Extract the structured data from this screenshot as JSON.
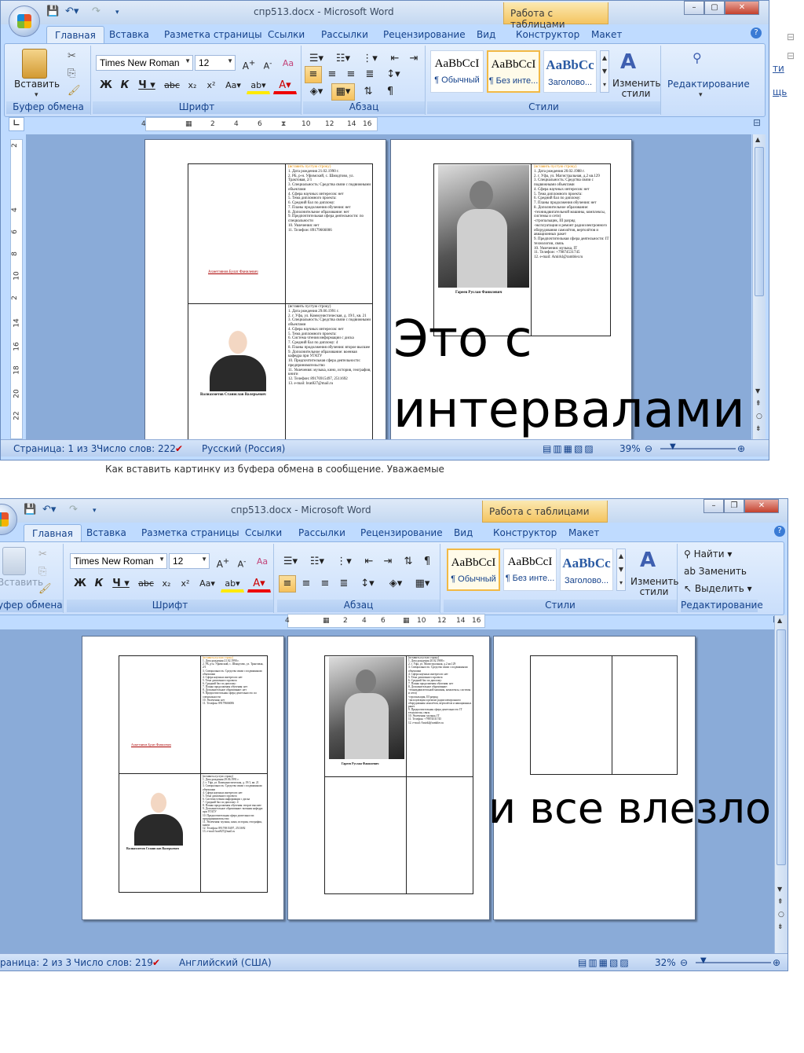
{
  "top": {
    "title": "спр513.docx - Microsoft Word",
    "context_tab": "Работа с таблицами",
    "tabs": [
      "Главная",
      "Вставка",
      "Разметка страницы",
      "Ссылки",
      "Рассылки",
      "Рецензирование",
      "Вид",
      "Конструктор",
      "Макет"
    ],
    "font_name": "Times New Roman",
    "font_size": "12",
    "paste": "Вставить",
    "styles": [
      {
        "sample": "AaBbCcI",
        "name": "¶ Обычный"
      },
      {
        "sample": "AaBbCcI",
        "name": "¶ Без инте..."
      },
      {
        "sample": "AaBbCc",
        "name": "Заголово..."
      }
    ],
    "change_styles": "Изменить стили",
    "editing": "Редактирование",
    "groups": [
      "Буфер обмена",
      "Шрифт",
      "Абзац",
      "Стили"
    ],
    "ruler": [
      "4",
      "2",
      "4",
      "6",
      "8",
      "10",
      "12",
      "14",
      "16"
    ],
    "vruler": [
      "2",
      "2",
      "4",
      "6",
      "8",
      "10",
      "12",
      "14",
      "16",
      "18",
      "20",
      "22"
    ],
    "status": {
      "page": "Страница: 1 из 3",
      "words": "Число слов: 222",
      "lang": "Русский (Россия)",
      "zoom": "39%"
    },
    "annotation": "Это с\nинтервалами",
    "side_links": [
      "ти",
      "щь"
    ],
    "below_text": "Как вставить картинку из буфера обмена в сообщение. Уважаемые"
  },
  "bottom": {
    "title": "спр513.docx - Microsoft Word",
    "context_tab": "Работа с таблицами",
    "tabs": [
      "Главная",
      "Вставка",
      "Разметка страницы",
      "Ссылки",
      "Рассылки",
      "Рецензирование",
      "Вид",
      "Конструктор",
      "Макет"
    ],
    "font_name": "Times New Roman",
    "font_size": "12",
    "paste": "Вставить",
    "styles": [
      {
        "sample": "AaBbCcI",
        "name": "¶ Обычный"
      },
      {
        "sample": "AaBbCcI",
        "name": "¶ Без инте..."
      },
      {
        "sample": "AaBbCc",
        "name": "Заголово..."
      }
    ],
    "change_styles": "Изменить стили",
    "find": "Найти",
    "replace": "Заменить",
    "select": "Выделить",
    "groups": [
      "уфер обмена",
      "Шрифт",
      "Абзац",
      "Стили",
      "Редактирование"
    ],
    "ruler": [
      "4",
      "2",
      "4",
      "6",
      "8",
      "10",
      "12",
      "14",
      "16"
    ],
    "status": {
      "page": "раница: 2 из 3",
      "words": "Число слов: 219",
      "lang": "Английский (США)",
      "zoom": "32%"
    },
    "annotation": "и все влезло"
  },
  "doc": {
    "person1": "Ахметзянов Булат Фанилевич",
    "person2": "Валиахметов Станислав Валерьевич",
    "person3": "Гареев Руслан Фанилевич",
    "insert_line": "(вставить пустую строку)",
    "p1_items": [
      "1. Дата рождения 21.02.1990 г.",
      "2. РБ, р-н. Уфимский, с. Шмидтово, ул. Трактовая, 2/1",
      "3. Специальность: Средства связи с подвижными объектами",
      "4. Сфера научных интересов: нет",
      "5. Тема дипломного проекта:",
      "6. Средний бал по диплому:",
      "7. Планы продолжения обучения: нет",
      "8. Дополнительное образование: нет",
      "9. Предпочтительная сфера деятельности: по специальности",
      "10. Увлечения: нет",
      "11. Телефон: 89179666006"
    ],
    "p2_items": [
      "1. Дата рождения 29.06.1991 г.",
      "2. г. Уфа, ул. Коммунистическая, д. 19/1, кв. 21",
      "3. Специальность: Средства связи с подвижными объектами",
      "4. Сфера научных интересов: нет",
      "5. Тема дипломного проекта:",
      "6. Система чтения информации с диска",
      "7. Средний бал по диплому: 4",
      "8. Планы продолжения обучения: второе высшее",
      "9. Дополнительное образование: военная кафедра при УГАТУ",
      "10. Предпочтительная сфера деятельности: предпринимательство",
      "11. Увлечения: музыка, кино, история, география, книги",
      "12. Телефон: 89176915497, 2511692",
      "13. e-mail: brat827@mail.ru"
    ],
    "p3_items": [
      "1. Дата рождения 20.02.1988 г.",
      "2. г. Уфа, ул. Магистральная, д.2 кв.129",
      "3. Специальность: Средства связи с подвижными объектами",
      "4. Сфера научных интересов: нет",
      "5. Тема дипломного проекта:",
      "6. Средний бал по диплому:",
      "7. Планы продолжения обучения: нет",
      "8. Дополнительное образование:",
      "-техникдвигательной машины, комплексы, системы и сети)",
      "-стропальщик, III разряд",
      "-эксплуатация и ремонт радиоэлектронного оборудования самолётов, вертолётов и авиационных ракет",
      "9. Предпочтительная сфера деятельности: IT технологии, связь",
      "10. Увлечения: музыка, IT",
      "11. Телефон: +79874531745",
      "12. e-mail: Amirkl@rambler.ru"
    ]
  }
}
